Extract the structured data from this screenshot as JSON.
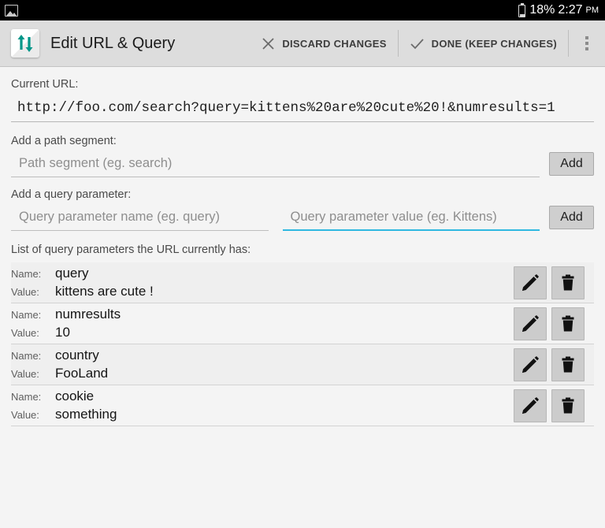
{
  "status_bar": {
    "left_icon": "image-icon",
    "battery_percent": "18%",
    "time": "2:27",
    "ampm": "PM"
  },
  "action_bar": {
    "app_icon": "up-down-arrows-icon",
    "title": "Edit URL & Query",
    "discard_label": "DISCARD CHANGES",
    "discard_icon": "close-x-icon",
    "done_label": "DONE (KEEP CHANGES)",
    "done_icon": "check-icon",
    "overflow_icon": "overflow-menu-icon",
    "bar_color": "#dddddd"
  },
  "current_url": {
    "label": "Current URL:",
    "value": "http://foo.com/search?query=kittens%20are%20cute%20!&numresults=1"
  },
  "path_segment": {
    "label": "Add a path segment:",
    "placeholder": "Path segment (eg. search)",
    "value": "",
    "add_label": "Add"
  },
  "query_parameter": {
    "label": "Add a query parameter:",
    "name_placeholder": "Query parameter name (eg. query)",
    "name_value": "",
    "value_placeholder": "Query parameter value (eg. Kittens)",
    "value_value": "",
    "add_label": "Add",
    "focused_field": "value",
    "focus_color": "#2fb8e0"
  },
  "param_list": {
    "label": "List of query parameters the URL currently has:",
    "name_key": "Name:",
    "value_key": "Value:",
    "edit_icon": "pencil-icon",
    "delete_icon": "trash-icon",
    "rows": [
      {
        "name": "query",
        "value": "kittens are cute !"
      },
      {
        "name": "numresults",
        "value": "10"
      },
      {
        "name": "country",
        "value": "FooLand"
      },
      {
        "name": "cookie",
        "value": "something"
      }
    ]
  }
}
